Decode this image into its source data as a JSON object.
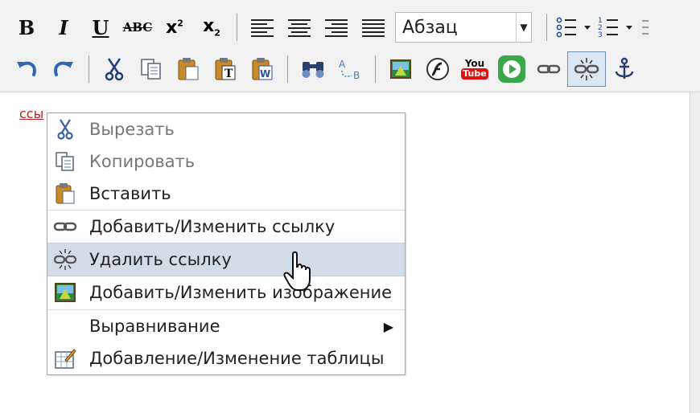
{
  "toolbar": {
    "row1": [
      {
        "icon": "bold-icon",
        "text": "B"
      },
      {
        "icon": "italic-icon",
        "text": "I"
      },
      {
        "icon": "underline-icon",
        "text": "U"
      },
      {
        "icon": "strikethrough-icon",
        "text": "ABC"
      },
      {
        "icon": "superscript-icon",
        "text": "x"
      },
      {
        "icon": "subscript-icon",
        "text": "x"
      }
    ],
    "format_select": {
      "value": "Абзац"
    },
    "row2_youtube": {
      "line1": "You",
      "line2": "Tube"
    }
  },
  "editor": {
    "link_text": "ссы"
  },
  "context_menu": {
    "items": [
      {
        "label": "Вырезать",
        "icon": "scissors-icon",
        "disabled": true
      },
      {
        "label": "Копировать",
        "icon": "copy-icon",
        "disabled": true
      },
      {
        "label": "Вставить",
        "icon": "paste-icon",
        "disabled": false
      },
      {
        "label": "Добавить/Изменить ссылку",
        "icon": "link-icon",
        "disabled": false
      },
      {
        "label": "Удалить ссылку",
        "icon": "unlink-icon",
        "disabled": false,
        "highlighted": true
      },
      {
        "label": "Добавить/Изменить изображение",
        "icon": "image-icon",
        "disabled": false
      },
      {
        "label": "Выравнивание",
        "icon": "",
        "submenu": true
      },
      {
        "label": "Добавление/Изменение таблицы",
        "icon": "table-icon",
        "disabled": false
      }
    ]
  }
}
